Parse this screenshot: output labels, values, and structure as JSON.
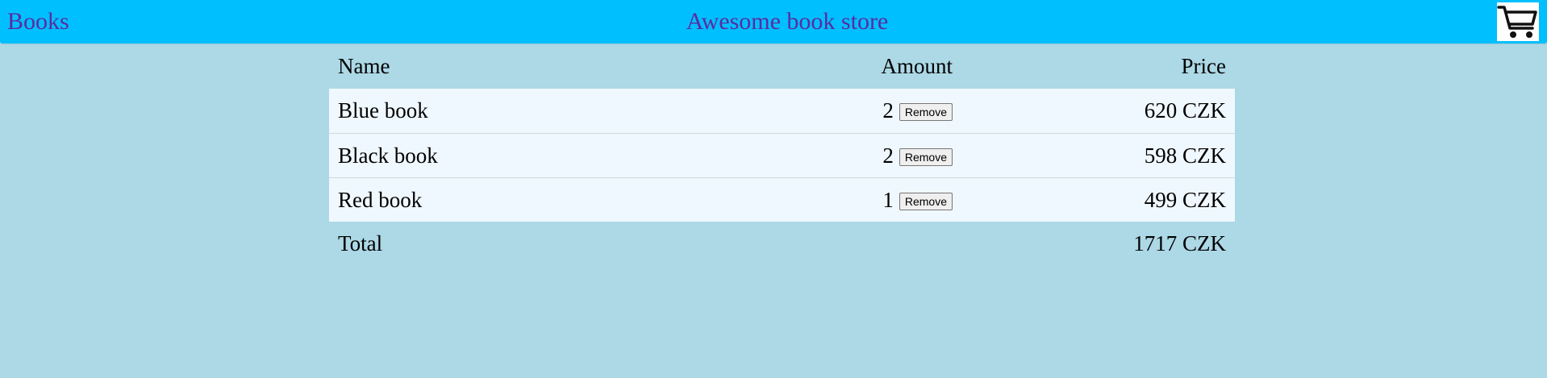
{
  "header": {
    "nav_label": "Books",
    "title": "Awesome book store",
    "cart_icon": "shopping-cart-icon"
  },
  "table": {
    "headers": {
      "name": "Name",
      "amount": "Amount",
      "price": "Price"
    },
    "items": [
      {
        "name": "Blue book",
        "amount": "2",
        "price": "620 CZK",
        "remove_label": "Remove"
      },
      {
        "name": "Black book",
        "amount": "2",
        "price": "598 CZK",
        "remove_label": "Remove"
      },
      {
        "name": "Red book",
        "amount": "1",
        "price": "499 CZK",
        "remove_label": "Remove"
      }
    ],
    "total": {
      "label": "Total",
      "price": "1717 CZK"
    }
  },
  "colors": {
    "page_background": "#add8e6",
    "header_background": "#00bfff",
    "header_text": "#5a2ca0",
    "row_background": "#f0f8ff"
  }
}
